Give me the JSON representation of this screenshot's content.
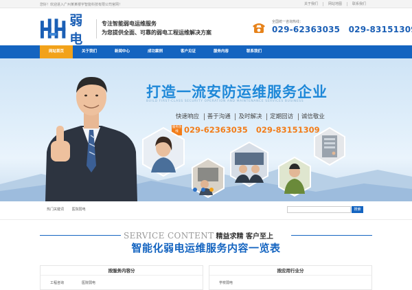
{
  "topbar": {
    "welcome": "您好！欢迎进入广州某某楼宇智能科技有限公司官网！",
    "links": [
      "关于我们",
      "网站地图",
      "联系我们"
    ]
  },
  "header": {
    "logo_text": "弱 电",
    "slogan_line1": "专注智能弱电运维服务",
    "slogan_line2": "为您提供全面、可靠的弱电工程运维解决方案",
    "hotline_label": "全国统一咨询热线：",
    "hotline_numbers": [
      "029-62363035",
      "029-83151309"
    ]
  },
  "nav": {
    "items": [
      "网站首页",
      "关于我们",
      "新闻中心",
      "成功案例",
      "客户见证",
      "服务内容",
      "联系我们"
    ],
    "active_index": 0
  },
  "banner": {
    "title": "打造一流安防运维服务企业",
    "subtitle_en": "BUILD FIRST-CLASS SECURITY OPERATION AND MAINTENANCE SERVICES BUSINESS",
    "features": [
      "快速响应",
      "善于沟通",
      "及时解决",
      "定期回访",
      "诚信敬业"
    ],
    "hot_tag": "服务热线",
    "hot_numbers": [
      "029-62363035",
      "029-83151309"
    ],
    "slide_count": 3,
    "active_slide": 2
  },
  "search": {
    "hot_label": "热门关键词",
    "hot_words": [
      "医院弱电"
    ],
    "placeholder": "",
    "button_label": "搜索"
  },
  "service": {
    "title_en": "SERVICE CONTENT",
    "title_cn": "精益求精 客户至上",
    "main_heading": "智能化弱电运维服务内容一览表"
  },
  "boxes": [
    {
      "heading": "按服务内容分",
      "items": [
        "工程咨询",
        "医院弱电"
      ]
    },
    {
      "heading": "按应用行业分",
      "items": [
        "学校弱电"
      ]
    }
  ],
  "colors": {
    "brand_blue": "#1464c0",
    "nav_active": "#f2a21a",
    "hotline_orange": "#f27d1a",
    "banner_title": "#1e88d8"
  }
}
